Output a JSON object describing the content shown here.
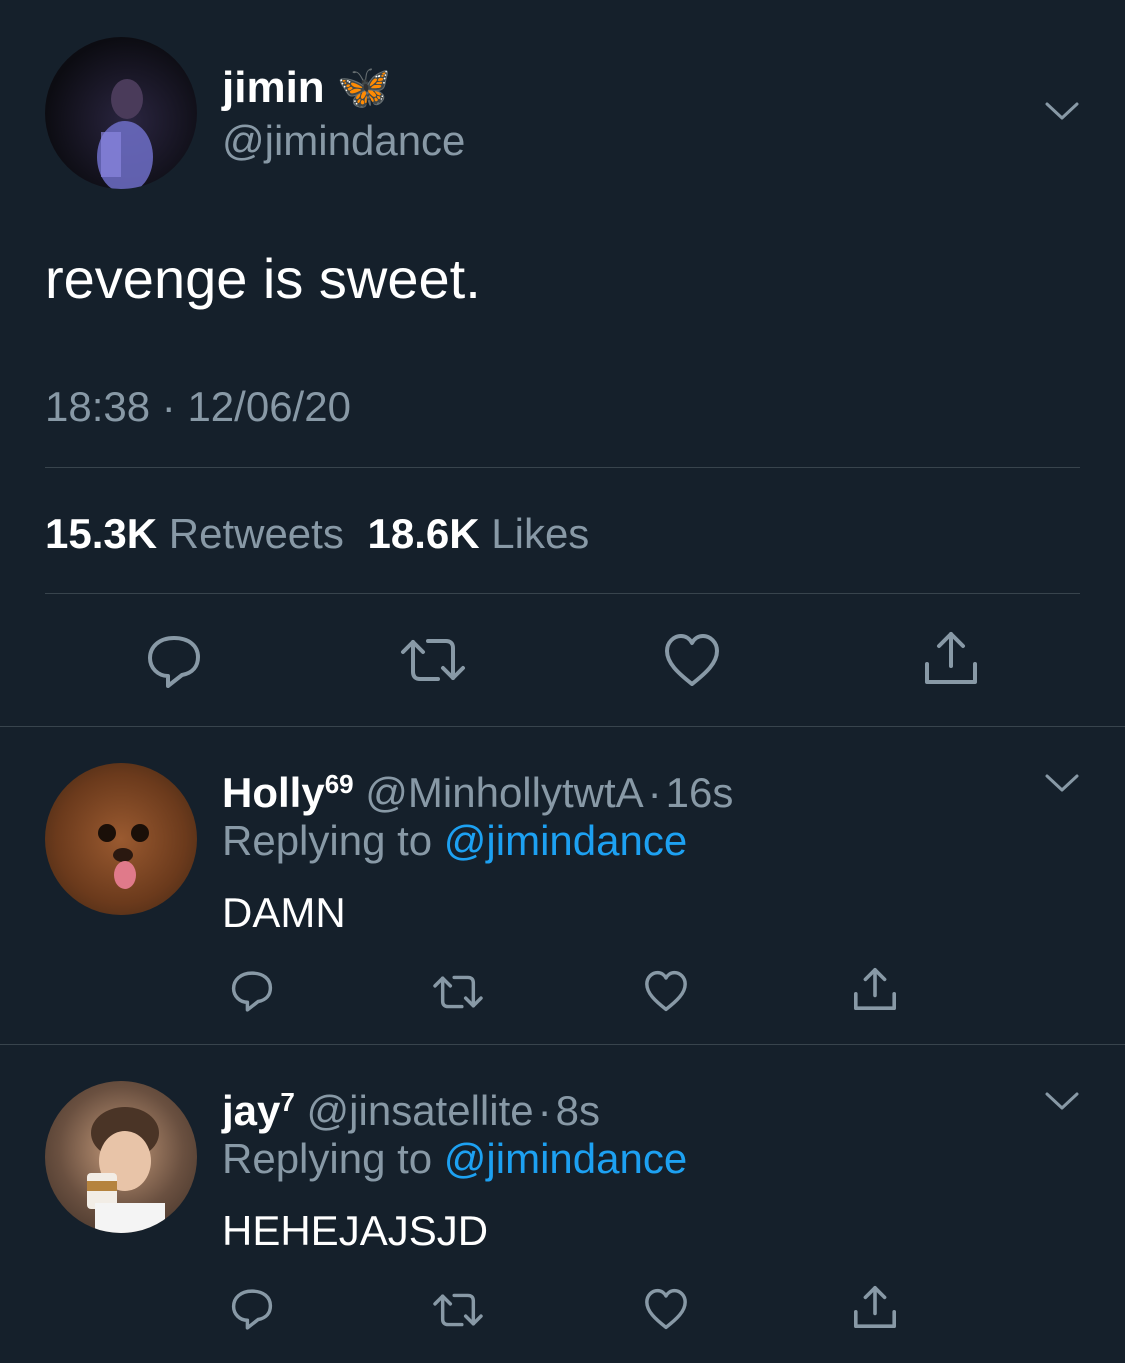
{
  "tweet": {
    "display_name": "jimin",
    "name_emoji": "🦋",
    "handle": "@jimindance",
    "text": "revenge is sweet.",
    "time": "18:38",
    "date_sep": "·",
    "date": "12/06/20",
    "retweets_count": "15.3K",
    "retweets_label": "Retweets",
    "likes_count": "18.6K",
    "likes_label": "Likes"
  },
  "replies": [
    {
      "display_name": "Holly",
      "name_sup": "69",
      "handle": "@MinhollytwtA",
      "dot": "·",
      "time": "16s",
      "replying_to_label": "Replying to",
      "replying_to_handle": "@jimindance",
      "text": "DAMN"
    },
    {
      "display_name": "jay",
      "name_sup": "7",
      "handle": "@jinsatellite",
      "dot": "·",
      "time": "8s",
      "replying_to_label": "Replying to",
      "replying_to_handle": "@jimindance",
      "text": "HEHEJAJSJD"
    }
  ],
  "icons": {
    "reply": "reply-icon",
    "retweet": "retweet-icon",
    "like": "heart-icon",
    "share": "share-icon",
    "more": "chevron-down-icon"
  },
  "colors": {
    "background": "#15202b",
    "text": "#ffffff",
    "muted": "#8899a6",
    "link": "#1da1f2",
    "divider": "#38444d"
  }
}
